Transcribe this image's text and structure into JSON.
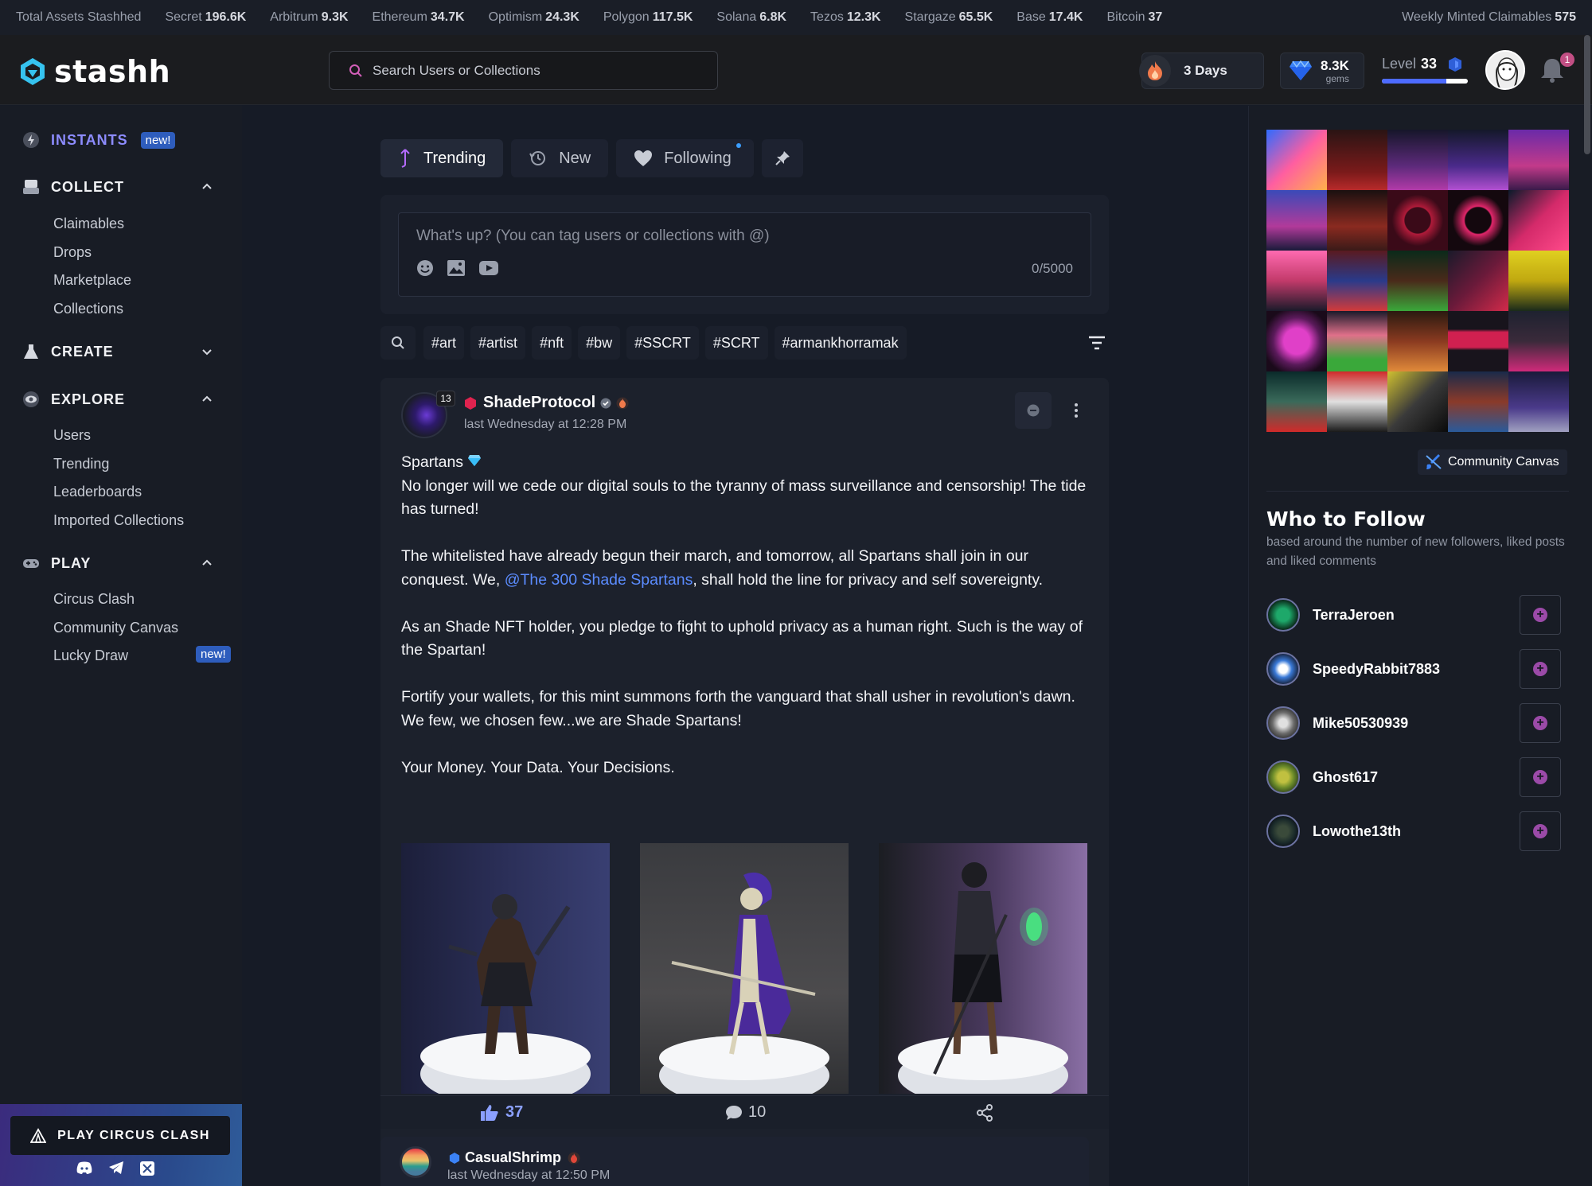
{
  "ticker": {
    "items": [
      {
        "label": "Total Assets Stashhed",
        "value": ""
      },
      {
        "label": "Secret",
        "value": "196.6K"
      },
      {
        "label": "Arbitrum",
        "value": "9.3K"
      },
      {
        "label": "Ethereum",
        "value": "34.7K"
      },
      {
        "label": "Optimism",
        "value": "24.3K"
      },
      {
        "label": "Polygon",
        "value": "117.5K"
      },
      {
        "label": "Solana",
        "value": "6.8K"
      },
      {
        "label": "Tezos",
        "value": "12.3K"
      },
      {
        "label": "Stargaze",
        "value": "65.5K"
      },
      {
        "label": "Base",
        "value": "17.4K"
      },
      {
        "label": "Bitcoin",
        "value": "37"
      }
    ],
    "weekly_label": "Weekly Minted Claimables",
    "weekly_value": "575"
  },
  "header": {
    "brand": "stashh",
    "search_placeholder": "Search Users or Collections",
    "streak": "3 Days",
    "gems_value": "8.3K",
    "gems_unit": "gems",
    "level_label": "Level",
    "level_value": "33",
    "level_progress_pct": 75,
    "notifications": "1"
  },
  "sidebar": {
    "instants": {
      "label": "INSTANTS",
      "badge": "new!"
    },
    "collect": {
      "label": "COLLECT",
      "items": [
        "Claimables",
        "Drops",
        "Marketplace",
        "Collections"
      ]
    },
    "create": {
      "label": "CREATE"
    },
    "explore": {
      "label": "EXPLORE",
      "items": [
        "Users",
        "Trending",
        "Leaderboards",
        "Imported Collections"
      ]
    },
    "play": {
      "label": "PLAY",
      "items": [
        "Circus Clash",
        "Community Canvas",
        "Lucky Draw"
      ],
      "lucky_badge": "new!"
    },
    "cta": "PLAY CIRCUS CLASH"
  },
  "feed": {
    "tabs": [
      {
        "label": "Trending",
        "icon": "trending-icon"
      },
      {
        "label": "New",
        "icon": "history-icon"
      },
      {
        "label": "Following",
        "icon": "heart-icon"
      }
    ],
    "composer_placeholder": "What's up? (You can tag users or collections with @)",
    "char_count": "0/5000",
    "tags": [
      "#art",
      "#artist",
      "#nft",
      "#bw",
      "#SSCRT",
      "#SCRT",
      "#armankhorramak"
    ]
  },
  "post": {
    "author": "ShadeProtocol",
    "level": "13",
    "time": "last Wednesday at 12:28 PM",
    "title": "Spartans",
    "p1": "No longer will we cede our digital souls to the tyranny of mass surveillance and censorship! The tide has turned!",
    "p2_before": "The whitelisted have already begun their march, and tomorrow, all Spartans shall join in our conquest. We, ",
    "p2_mention": "@The 300 Shade Spartans",
    "p2_after": ", shall hold the line for privacy and self sovereignty.",
    "p3": "As an Shade NFT holder, you pledge to fight to uphold privacy as a human right. Such is the way of the Spartan!",
    "p4": "Fortify your wallets, for this mint summons forth the vanguard that shall usher in revolution's dawn. We few, we chosen few...we are Shade Spartans!",
    "p5": "Your Money. Your Data. Your Decisions.",
    "likes": "37",
    "comments": "10"
  },
  "comment": {
    "author": "CasualShrimp",
    "time": "last Wednesday at 12:50 PM"
  },
  "right": {
    "canvas_button": "Community Canvas",
    "who_title": "Who to Follow",
    "who_sub": "based around the number of new followers, liked posts and liked comments",
    "users": [
      "TerraJeroen",
      "SpeedyRabbit7883",
      "Mike50530939",
      "Ghost617",
      "Lowothe13th"
    ]
  },
  "colors": {
    "accent": "#5b8cff",
    "instants": "#8d8cff",
    "badge": "#2e5dbd",
    "follow_plus": "#9b4aa8"
  }
}
